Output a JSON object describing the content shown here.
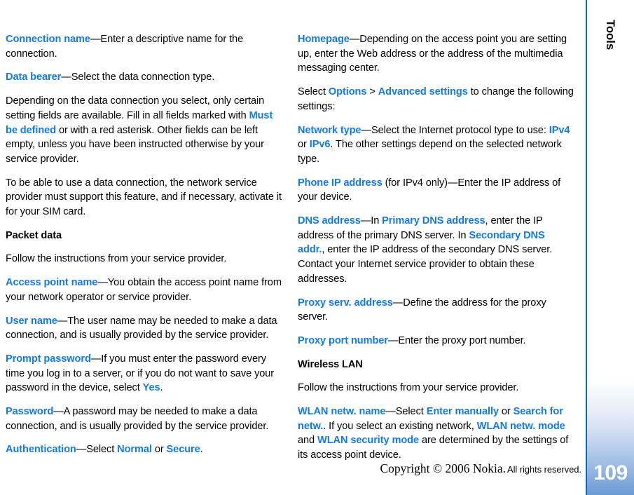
{
  "document": {
    "chapter_label": "Tools",
    "page_number": "109",
    "footer": {
      "copyright_serif": "Copyright © 2006 Nokia.",
      "copyright_sans": "All rights reserved."
    },
    "colors": {
      "link_blue": "#147be6",
      "rule_blue": "#0b6ab5",
      "tab_gradient_bottom": "#6a9bd4",
      "body_text": "#000000"
    }
  },
  "columns": {
    "left": [
      {
        "name": "paragraph-connection-name",
        "style": "body",
        "segments": [
          {
            "t": "Connection name",
            "s": "link"
          },
          {
            "t": "—Enter a descriptive name for the connection.",
            "s": "plain"
          }
        ]
      },
      {
        "name": "paragraph-data-bearer",
        "style": "body",
        "segments": [
          {
            "t": "Data bearer",
            "s": "link"
          },
          {
            "t": "—Select the data connection type.",
            "s": "plain"
          }
        ]
      },
      {
        "name": "paragraph-depending-on-data-connection",
        "style": "body",
        "segments": [
          {
            "t": "Depending on the data connection you select, only certain setting fields are available. Fill in all fields marked with ",
            "s": "plain"
          },
          {
            "t": "Must be defined",
            "s": "link"
          },
          {
            "t": " or with a red asterisk. Other fields can be left empty, unless you have been instructed otherwise by your service provider.",
            "s": "plain"
          }
        ]
      },
      {
        "name": "paragraph-network-service-provider-support",
        "style": "body",
        "segments": [
          {
            "t": "To be able to use a data connection, the network service provider must support this feature, and if necessary, activate it for your SIM card.",
            "s": "plain"
          }
        ]
      },
      {
        "name": "heading-packet-data",
        "style": "heading",
        "segments": [
          {
            "t": "Packet data",
            "s": "plain"
          }
        ]
      },
      {
        "name": "paragraph-follow-instructions-packet-data",
        "style": "body",
        "segments": [
          {
            "t": "Follow the instructions from your service provider.",
            "s": "plain"
          }
        ]
      },
      {
        "name": "paragraph-access-point-name",
        "style": "body",
        "segments": [
          {
            "t": "Access point name",
            "s": "link"
          },
          {
            "t": "—You obtain the access point name from your network operator or service provider.",
            "s": "plain"
          }
        ]
      },
      {
        "name": "paragraph-user-name",
        "style": "body",
        "segments": [
          {
            "t": "User name",
            "s": "link"
          },
          {
            "t": "—The user name may be needed to make a data connection, and is usually provided by the service provider.",
            "s": "plain"
          }
        ]
      },
      {
        "name": "paragraph-prompt-password",
        "style": "body",
        "segments": [
          {
            "t": "Prompt password",
            "s": "link"
          },
          {
            "t": "—If you must enter the password every time you log in to a server, or if you do not want to save your password in the device, select ",
            "s": "plain"
          },
          {
            "t": "Yes",
            "s": "link"
          },
          {
            "t": ".",
            "s": "plain"
          }
        ]
      },
      {
        "name": "paragraph-password",
        "style": "body",
        "segments": [
          {
            "t": "Password",
            "s": "link"
          },
          {
            "t": "—A password may be needed to make a data connection, and is usually provided by the service provider.",
            "s": "plain"
          }
        ]
      },
      {
        "name": "paragraph-authentication",
        "style": "body",
        "segments": [
          {
            "t": "Authentication",
            "s": "link"
          },
          {
            "t": "—Select ",
            "s": "plain"
          },
          {
            "t": "Normal",
            "s": "link"
          },
          {
            "t": " or ",
            "s": "plain"
          },
          {
            "t": "Secure",
            "s": "link"
          },
          {
            "t": ".",
            "s": "plain"
          }
        ]
      }
    ],
    "right": [
      {
        "name": "paragraph-homepage",
        "style": "body",
        "segments": [
          {
            "t": "Homepage",
            "s": "link"
          },
          {
            "t": "—Depending on the access point you are setting up, enter the Web address or the address of the multimedia messaging center.",
            "s": "plain"
          }
        ]
      },
      {
        "name": "paragraph-select-options-advanced-settings",
        "style": "body",
        "segments": [
          {
            "t": "Select ",
            "s": "plain"
          },
          {
            "t": "Options",
            "s": "link"
          },
          {
            "t": " > ",
            "s": "plain"
          },
          {
            "t": "Advanced settings",
            "s": "link"
          },
          {
            "t": " to change the following settings:",
            "s": "plain"
          }
        ]
      },
      {
        "name": "paragraph-network-type",
        "style": "body",
        "segments": [
          {
            "t": "Network type",
            "s": "link"
          },
          {
            "t": "—Select the Internet protocol type to use: ",
            "s": "plain"
          },
          {
            "t": "IPv4",
            "s": "link"
          },
          {
            "t": " or ",
            "s": "plain"
          },
          {
            "t": "IPv6",
            "s": "link"
          },
          {
            "t": ". The other settings depend on the selected network type.",
            "s": "plain"
          }
        ]
      },
      {
        "name": "paragraph-phone-ip-address",
        "style": "body",
        "segments": [
          {
            "t": "Phone IP address",
            "s": "link"
          },
          {
            "t": " (for IPv4 only)—Enter the IP address of your device.",
            "s": "plain"
          }
        ]
      },
      {
        "name": "paragraph-dns-address",
        "style": "body",
        "segments": [
          {
            "t": "DNS address",
            "s": "link"
          },
          {
            "t": "—In ",
            "s": "plain"
          },
          {
            "t": "Primary DNS address",
            "s": "link"
          },
          {
            "t": ", enter the IP address of the primary DNS server. In ",
            "s": "plain"
          },
          {
            "t": "Secondary DNS addr.",
            "s": "link"
          },
          {
            "t": ", enter the IP address of the secondary DNS server. Contact your Internet service provider to obtain these addresses.",
            "s": "plain"
          }
        ]
      },
      {
        "name": "paragraph-proxy-serv-address",
        "style": "body",
        "segments": [
          {
            "t": "Proxy serv. address",
            "s": "link"
          },
          {
            "t": "—Define the address for the proxy server.",
            "s": "plain"
          }
        ]
      },
      {
        "name": "paragraph-proxy-port-number",
        "style": "body",
        "segments": [
          {
            "t": "Proxy port number",
            "s": "link"
          },
          {
            "t": "—Enter the proxy port number.",
            "s": "plain"
          }
        ]
      },
      {
        "name": "heading-wireless-lan",
        "style": "heading",
        "segments": [
          {
            "t": "Wireless LAN",
            "s": "plain"
          }
        ]
      },
      {
        "name": "paragraph-follow-instructions-wlan",
        "style": "body",
        "segments": [
          {
            "t": "Follow the instructions from your service provider.",
            "s": "plain"
          }
        ]
      },
      {
        "name": "paragraph-wlan-netw-name",
        "style": "body",
        "segments": [
          {
            "t": "WLAN netw. name",
            "s": "link"
          },
          {
            "t": "—Select ",
            "s": "plain"
          },
          {
            "t": "Enter manually",
            "s": "link"
          },
          {
            "t": " or ",
            "s": "plain"
          },
          {
            "t": "Search for netw.",
            "s": "link"
          },
          {
            "t": ". If you select an existing network, ",
            "s": "plain"
          },
          {
            "t": "WLAN netw. mode",
            "s": "link"
          },
          {
            "t": " and ",
            "s": "plain"
          },
          {
            "t": "WLAN security mode",
            "s": "link"
          },
          {
            "t": " are determined by the settings of its access point device.",
            "s": "plain"
          }
        ]
      }
    ]
  }
}
